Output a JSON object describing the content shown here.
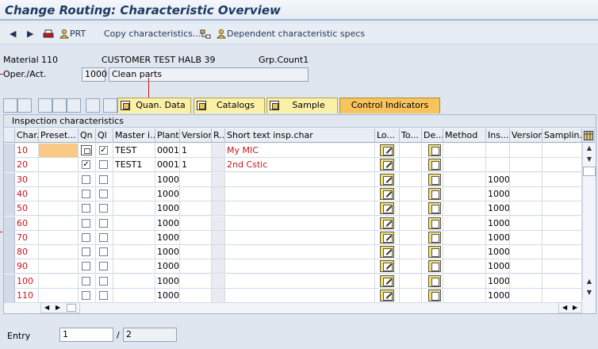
{
  "window": {
    "title": "Change Routing: Characteristic Overview"
  },
  "toolbar": {
    "prt_label": "PRT",
    "copy_label": "Copy  characteristics...",
    "dependent_label": "Dependent characteristic specs"
  },
  "header": {
    "material_label": "Material",
    "material_value": "110",
    "material_desc": "CUSTOMER TEST HALB 39",
    "grpcount_label": "Grp.Count1",
    "operation_label": "Oper./Act.",
    "operation_value": "1000",
    "operation_desc": "Clean parts"
  },
  "tabs": [
    {
      "label": "Quan. Data",
      "active": false
    },
    {
      "label": "Catalogs",
      "active": false
    },
    {
      "label": "Sample",
      "active": false
    },
    {
      "label": "Control Indicators",
      "active": true
    }
  ],
  "panel": {
    "title": "Inspection characteristics"
  },
  "table": {
    "columns": [
      "Char.",
      "Preset...",
      "Qn",
      "Ql",
      "Master i...",
      "Plant",
      "Version",
      "R..",
      "Short text insp.char",
      "Lo...",
      "To...",
      "De...",
      "Method",
      "Ins...",
      "Version",
      "Samplin..."
    ],
    "rows": [
      {
        "char": "10",
        "qn": "qbutton",
        "ql": true,
        "master": "TEST",
        "plant": "0001",
        "version": "1",
        "short": "My MIC",
        "ins": ""
      },
      {
        "char": "20",
        "qn": "checked",
        "ql": false,
        "master": "TEST1",
        "plant": "0001",
        "version": "1",
        "short": "2nd Cstic",
        "ins": ""
      },
      {
        "char": "30",
        "qn": "unchecked",
        "ql": false,
        "master": "",
        "plant": "1000",
        "version": "",
        "short": "",
        "ins": "1000"
      },
      {
        "char": "40",
        "qn": "unchecked",
        "ql": false,
        "master": "",
        "plant": "1000",
        "version": "",
        "short": "",
        "ins": "1000"
      },
      {
        "char": "50",
        "qn": "unchecked",
        "ql": false,
        "master": "",
        "plant": "1000",
        "version": "",
        "short": "",
        "ins": "1000"
      },
      {
        "char": "60",
        "qn": "unchecked",
        "ql": false,
        "master": "",
        "plant": "1000",
        "version": "",
        "short": "",
        "ins": "1000"
      },
      {
        "char": "70",
        "qn": "unchecked",
        "ql": false,
        "master": "",
        "plant": "1000",
        "version": "",
        "short": "",
        "ins": "1000"
      },
      {
        "char": "80",
        "qn": "unchecked",
        "ql": false,
        "master": "",
        "plant": "1000",
        "version": "",
        "short": "",
        "ins": "1000"
      },
      {
        "char": "90",
        "qn": "unchecked",
        "ql": false,
        "master": "",
        "plant": "1000",
        "version": "",
        "short": "",
        "ins": "1000"
      },
      {
        "char": "100",
        "qn": "unchecked",
        "ql": false,
        "master": "",
        "plant": "1000",
        "version": "",
        "short": "",
        "ins": "1000"
      },
      {
        "char": "110",
        "qn": "unchecked",
        "ql": false,
        "master": "",
        "plant": "1000",
        "version": "",
        "short": "",
        "ins": "1000"
      }
    ]
  },
  "footer": {
    "entry_label": "Entry",
    "entry_value": "1",
    "separator": "/",
    "total_value": "2"
  },
  "colors": {
    "char_red": "#c8151b",
    "tab_yellow": "#fbf0a8",
    "tab_active": "#f7c35c"
  }
}
